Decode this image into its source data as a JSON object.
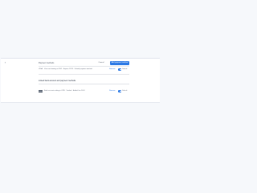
{
  "header": {
    "back_icon": "arrow-left-icon",
    "back_glyph": "‹",
    "title": "Payment methods",
    "secondary_button": "Cancel",
    "primary_button": "Add payment method"
  },
  "existing_method": {
    "icon": "card-icon",
    "icon_glyph": "VISA",
    "description": "Visa card ending in 4242 · Expires 12/25 · Default payment method",
    "link": "Remove",
    "toggle_label": "Default"
  },
  "section": {
    "title": "Linked bank account and payment methods"
  },
  "linked_method": {
    "icon": "bank-card-icon",
    "description": "Bank account ending in 6789 · Verified · Added Jan 2024",
    "link": "Remove",
    "toggle_label": "Default"
  },
  "colors": {
    "accent": "#2f7be5",
    "background": "#f6f8fb",
    "panel": "#ffffff",
    "text_muted": "#6b7280"
  }
}
